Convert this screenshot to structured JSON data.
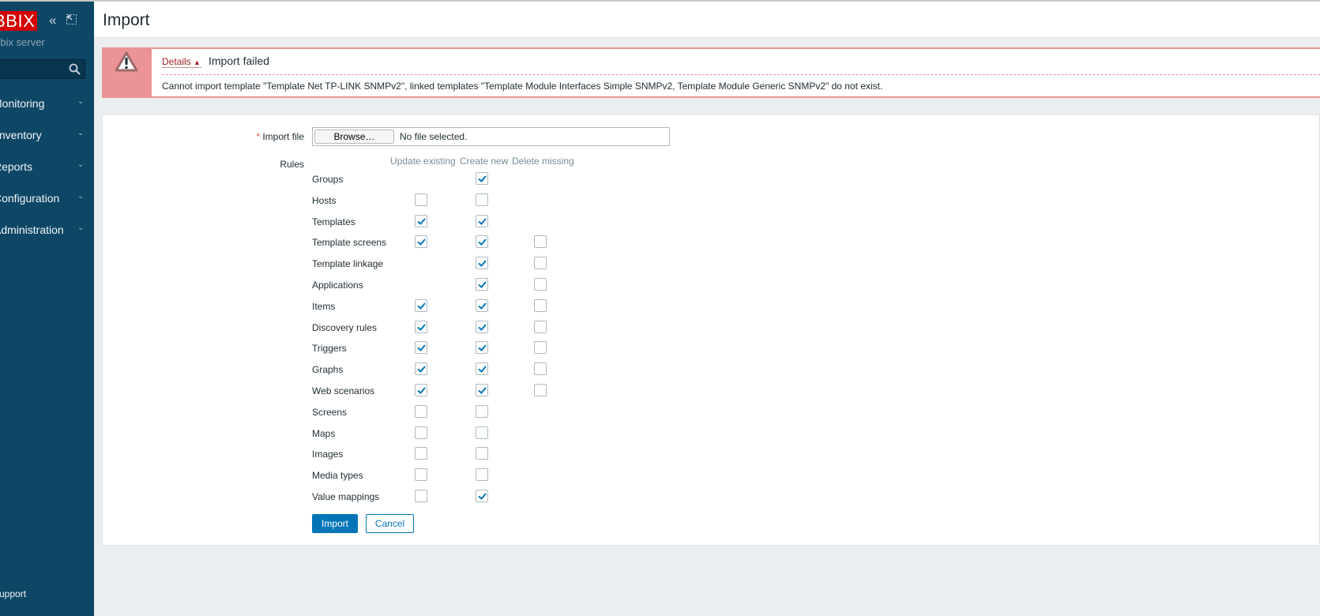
{
  "sidebar": {
    "logo": "ZABBIX",
    "server": "Zabbix server",
    "search_placeholder": "",
    "menu": [
      {
        "label": "Monitoring"
      },
      {
        "label": "Inventory"
      },
      {
        "label": "Reports"
      },
      {
        "label": "Configuration"
      },
      {
        "label": "Administration"
      }
    ],
    "support": "Support"
  },
  "header": {
    "title": "Import"
  },
  "alert": {
    "details": "Details",
    "title": "Import failed",
    "message": "Cannot import template \"Template Net TP-LINK SNMPv2\", linked templates \"Template Module Interfaces Simple SNMPv2, Template Module Generic SNMPv2\" do not exist."
  },
  "form": {
    "import_file_label": "Import file",
    "browse": "Browse…",
    "no_file": "No file selected.",
    "rules_label": "Rules",
    "columns": [
      "Update existing",
      "Create new",
      "Delete missing"
    ],
    "rules": [
      {
        "label": "Groups",
        "update": null,
        "create": true,
        "delete": null
      },
      {
        "label": "Hosts",
        "update": false,
        "create": false,
        "delete": null
      },
      {
        "label": "Templates",
        "update": true,
        "create": true,
        "delete": null
      },
      {
        "label": "Template screens",
        "update": true,
        "create": true,
        "delete": false
      },
      {
        "label": "Template linkage",
        "update": null,
        "create": true,
        "delete": false
      },
      {
        "label": "Applications",
        "update": null,
        "create": true,
        "delete": false
      },
      {
        "label": "Items",
        "update": true,
        "create": true,
        "delete": false
      },
      {
        "label": "Discovery rules",
        "update": true,
        "create": true,
        "delete": false
      },
      {
        "label": "Triggers",
        "update": true,
        "create": true,
        "delete": false
      },
      {
        "label": "Graphs",
        "update": true,
        "create": true,
        "delete": false
      },
      {
        "label": "Web scenarios",
        "update": true,
        "create": true,
        "delete": false
      },
      {
        "label": "Screens",
        "update": false,
        "create": false,
        "delete": null
      },
      {
        "label": "Maps",
        "update": false,
        "create": false,
        "delete": null
      },
      {
        "label": "Images",
        "update": false,
        "create": false,
        "delete": null
      },
      {
        "label": "Media types",
        "update": false,
        "create": false,
        "delete": null
      },
      {
        "label": "Value mappings",
        "update": false,
        "create": true,
        "delete": null
      }
    ],
    "import_button": "Import",
    "cancel_button": "Cancel"
  },
  "colors": {
    "sidebar": "#0e4766",
    "accent": "#0275b8",
    "error": "#eb9495",
    "logo": "#d40000"
  }
}
